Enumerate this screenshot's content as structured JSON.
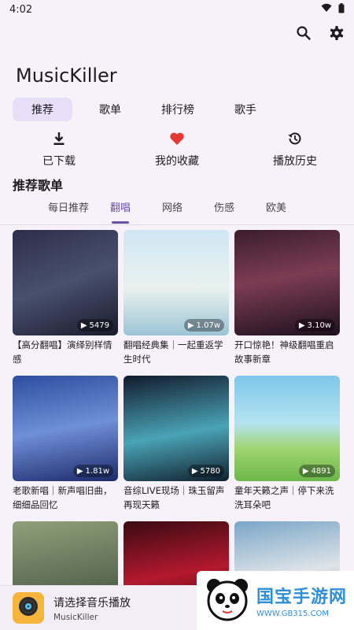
{
  "status": {
    "time": "4:02"
  },
  "app": {
    "title": "MusicKiller"
  },
  "tabs": [
    {
      "label": "推荐",
      "active": true
    },
    {
      "label": "歌单",
      "active": false
    },
    {
      "label": "排行榜",
      "active": false
    },
    {
      "label": "歌手",
      "active": false
    }
  ],
  "quick_actions": [
    {
      "label": "已下载",
      "icon": "download-icon"
    },
    {
      "label": "我的收藏",
      "icon": "heart-icon"
    },
    {
      "label": "播放历史",
      "icon": "history-icon"
    }
  ],
  "section": {
    "title": "推荐歌单"
  },
  "subtabs": [
    {
      "label": "每日推荐",
      "active": false
    },
    {
      "label": "翻唱",
      "active": true
    },
    {
      "label": "网络",
      "active": false
    },
    {
      "label": "伤感",
      "active": false
    },
    {
      "label": "欧美",
      "active": false
    }
  ],
  "playlists": [
    {
      "count": "5479",
      "title": "【高分翻唱】演绎别样情感"
    },
    {
      "count": "1.07w",
      "title": "翻唱经典集｜一起重返学生时代"
    },
    {
      "count": "3.10w",
      "title": "开口惊艳！神级翻唱重启故事新章"
    },
    {
      "count": "1.81w",
      "title": "老歌新唱｜新声唱旧曲，细细品回忆"
    },
    {
      "count": "5780",
      "title": "音综LIVE现场｜珠玉留声再现天籁"
    },
    {
      "count": "4891",
      "title": "童年天籁之声｜停下来洗洗耳朵吧"
    },
    {
      "count": "",
      "title": ""
    },
    {
      "count": "",
      "title": ""
    },
    {
      "count": "",
      "title": ""
    }
  ],
  "player": {
    "title": "请选择音乐播放",
    "subtitle": "MusicKiller"
  },
  "watermark": {
    "main": "国宝手游网",
    "url": "WWW.GB315.COM"
  },
  "colors": {
    "accent": "#6750a4",
    "heart": "#e53935",
    "tab_active_bg": "#e8def8"
  }
}
